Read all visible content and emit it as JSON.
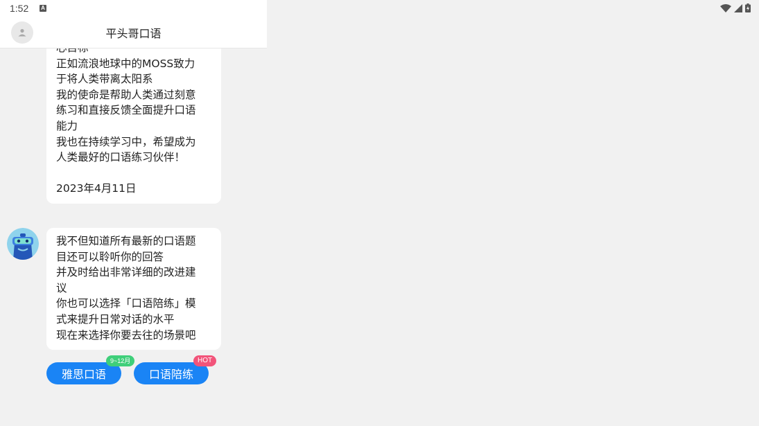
{
  "status_bar": {
    "time": "1:52",
    "a_icon_label": "A"
  },
  "header": {
    "title": "平头哥口语"
  },
  "messages": [
    {
      "lines": [
        "心目标",
        "正如流浪地球中的MOSS致力",
        "于将人类带离太阳系",
        "我的使命是帮助人类通过刻意",
        "练习和直接反馈全面提升口语",
        "能力",
        "我也在持续学习中，希望成为",
        "人类最好的口语练习伙伴！",
        "",
        "2023年4月11日"
      ]
    },
    {
      "lines": [
        "我不但知道所有最新的口语题",
        "目还可以聆听你的回答",
        "并及时给出非常详细的改进建",
        "议",
        "你也可以选择「口语陪练」模",
        "式来提升日常对话的水平",
        "现在来选择你要去往的场景吧"
      ]
    }
  ],
  "choices": [
    {
      "label": "雅思口语",
      "badge": "9~12月"
    },
    {
      "label": "口语陪练",
      "badge": "HOT"
    }
  ],
  "colors": {
    "accent": "#1a84f5",
    "badge_green": "#3fcf7a",
    "badge_pink": "#f2547a",
    "background": "#f1f1f1"
  }
}
